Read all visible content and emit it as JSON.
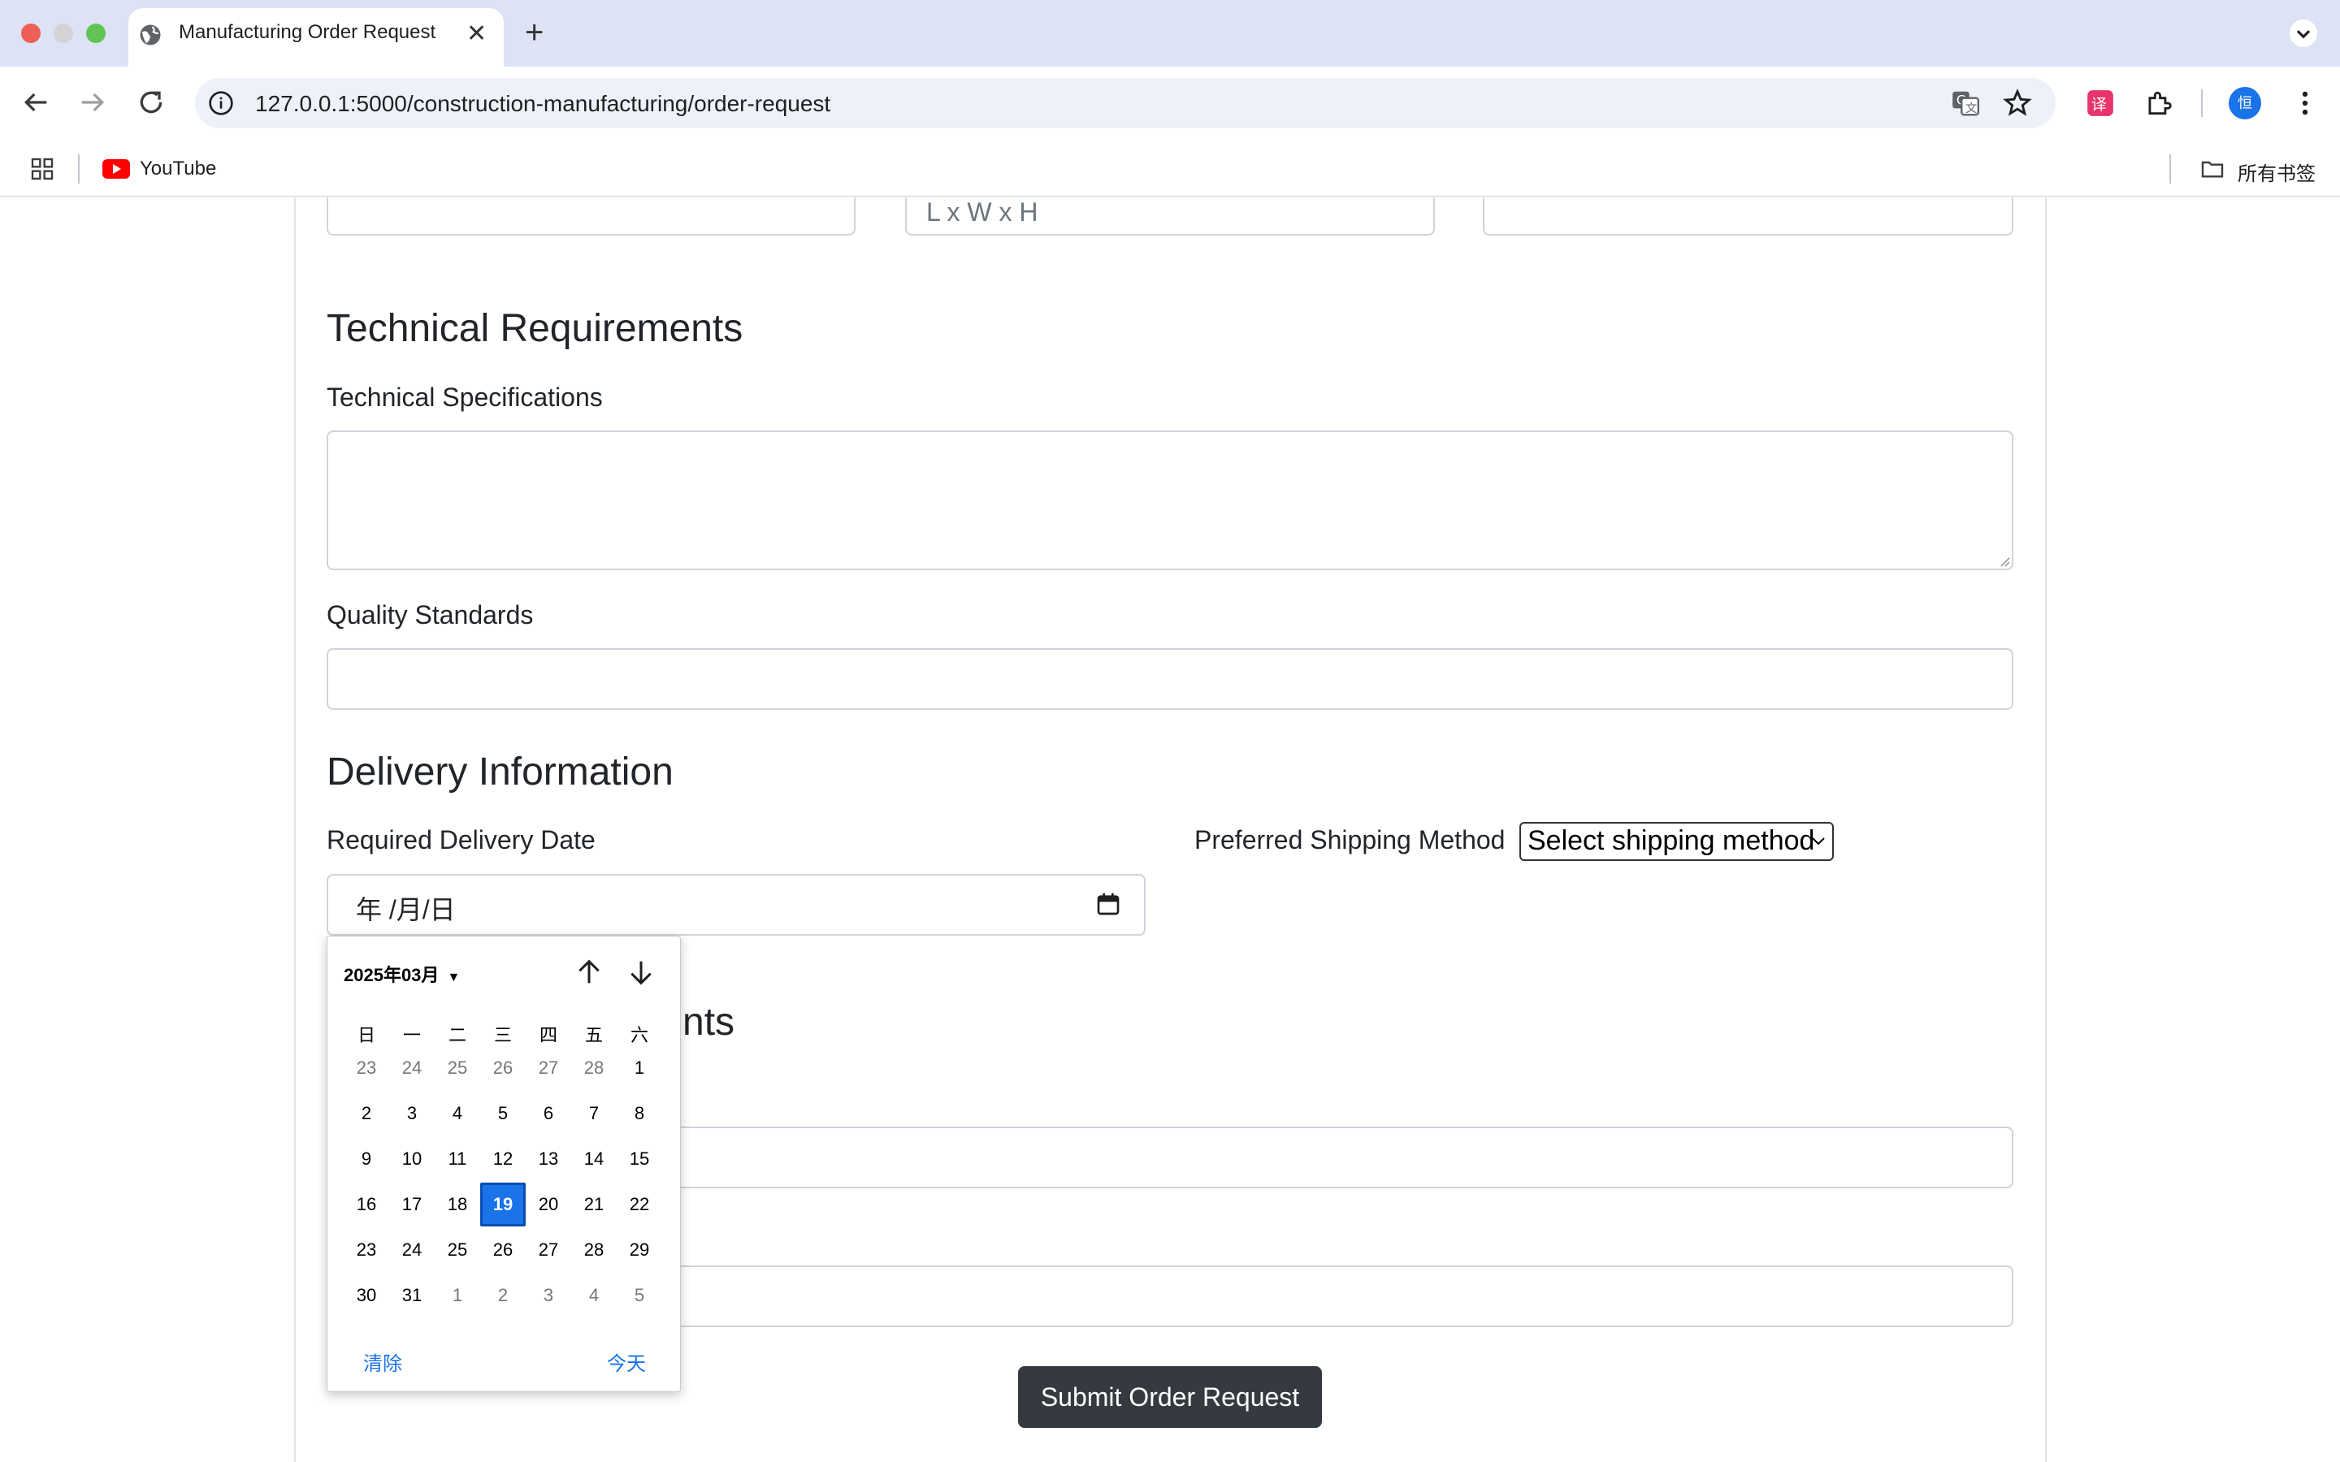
{
  "browser": {
    "tab_title": "Manufacturing Order Request",
    "url": "127.0.0.1:5000/construction-manufacturing/order-request",
    "bookmarks": [
      {
        "label": "YouTube"
      }
    ],
    "all_bookmarks_label": "所有书签",
    "avatar_letter": "恒"
  },
  "form": {
    "dimensions_placeholder": "L x W x H",
    "technical": {
      "heading": "Technical Requirements",
      "specs_label": "Technical Specifications",
      "quality_label": "Quality Standards"
    },
    "delivery": {
      "heading": "Delivery Information",
      "date_label": "Required Delivery Date",
      "date_placeholder": "年 /月/日",
      "shipping_label": "Preferred Shipping Method",
      "shipping_selected": "Select shipping method"
    },
    "next_heading_fragment": "nts",
    "submit_label": "Submit Order Request"
  },
  "datepicker": {
    "month_label": "2025年03月",
    "weekdays": [
      "日",
      "一",
      "二",
      "三",
      "四",
      "五",
      "六"
    ],
    "weeks": [
      [
        "23",
        "24",
        "25",
        "26",
        "27",
        "28",
        "1"
      ],
      [
        "2",
        "3",
        "4",
        "5",
        "6",
        "7",
        "8"
      ],
      [
        "9",
        "10",
        "11",
        "12",
        "13",
        "14",
        "15"
      ],
      [
        "16",
        "17",
        "18",
        "19",
        "20",
        "21",
        "22"
      ],
      [
        "23",
        "24",
        "25",
        "26",
        "27",
        "28",
        "29"
      ],
      [
        "30",
        "31",
        "1",
        "2",
        "3",
        "4",
        "5"
      ]
    ],
    "selected_day": "19",
    "clear_label": "清除",
    "today_label": "今天"
  }
}
